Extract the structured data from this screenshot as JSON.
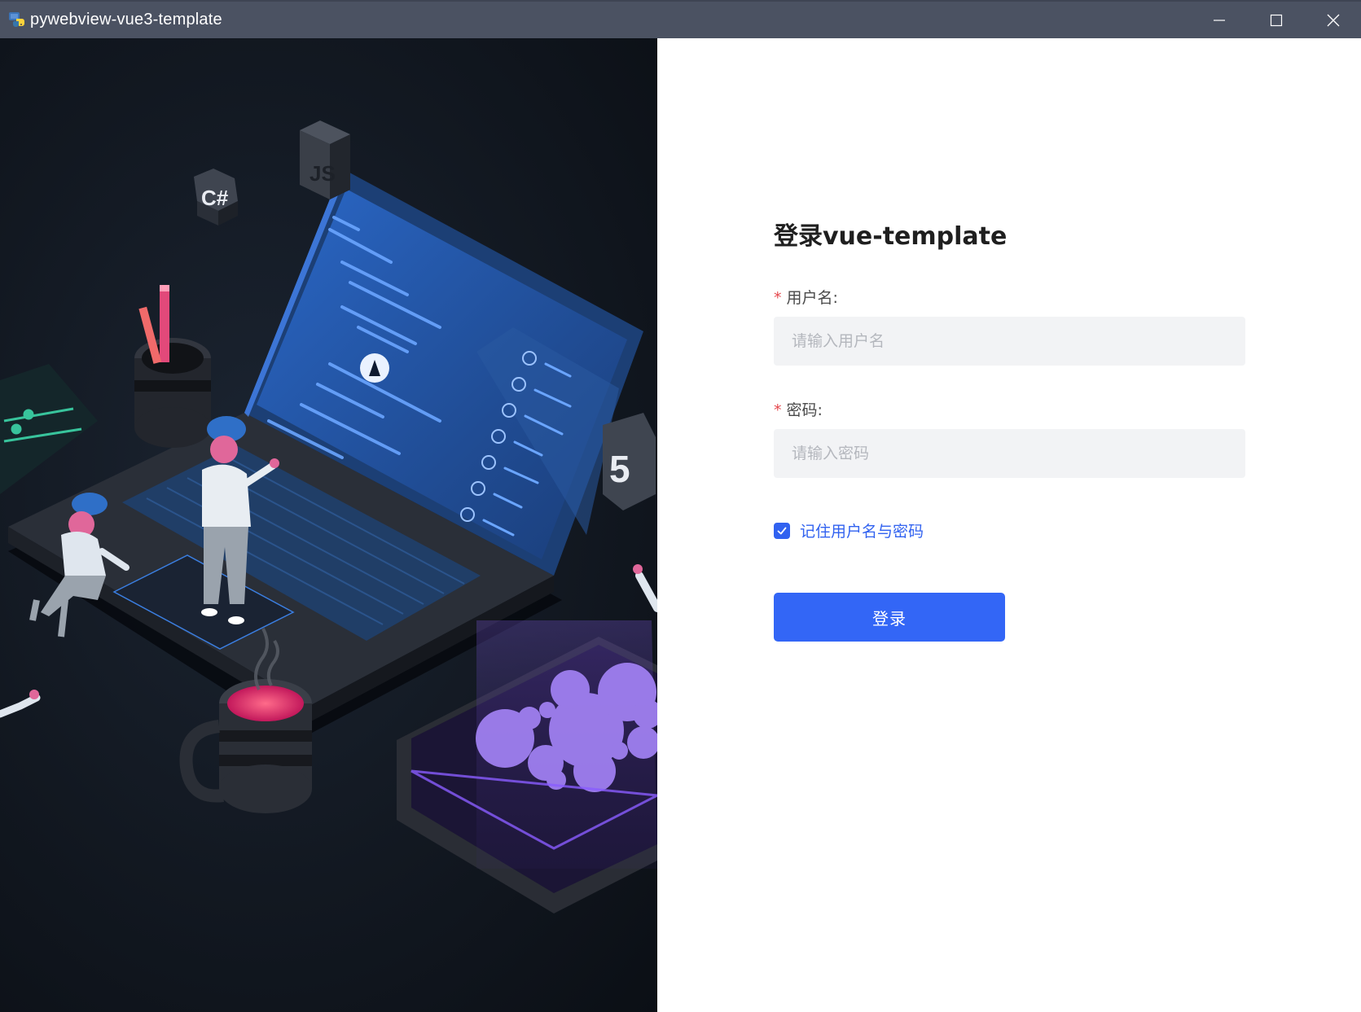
{
  "window": {
    "title": "pywebview-vue3-template",
    "icon": "python-icon",
    "controls": [
      "minimize-icon",
      "maximize-icon",
      "close-icon"
    ]
  },
  "illustration": {
    "description_icons": [
      "csharp-icon",
      "javascript-icon",
      "html5-icon"
    ],
    "js_badge": "JS",
    "csharp_badge": "C#",
    "html5_badge": "5"
  },
  "login": {
    "title": "登录vue-template",
    "username": {
      "label": "用户名:",
      "required_mark": "*",
      "placeholder": "请输入用户名",
      "value": ""
    },
    "password": {
      "label": "密码:",
      "required_mark": "*",
      "placeholder": "请输入密码",
      "value": ""
    },
    "remember": {
      "label": "记住用户名与密码",
      "checked": true
    },
    "submit_label": "登录"
  },
  "colors": {
    "titlebar": "#4b5262",
    "primary": "#3366f6",
    "input_bg": "#f2f3f5",
    "required": "#e5484d"
  }
}
